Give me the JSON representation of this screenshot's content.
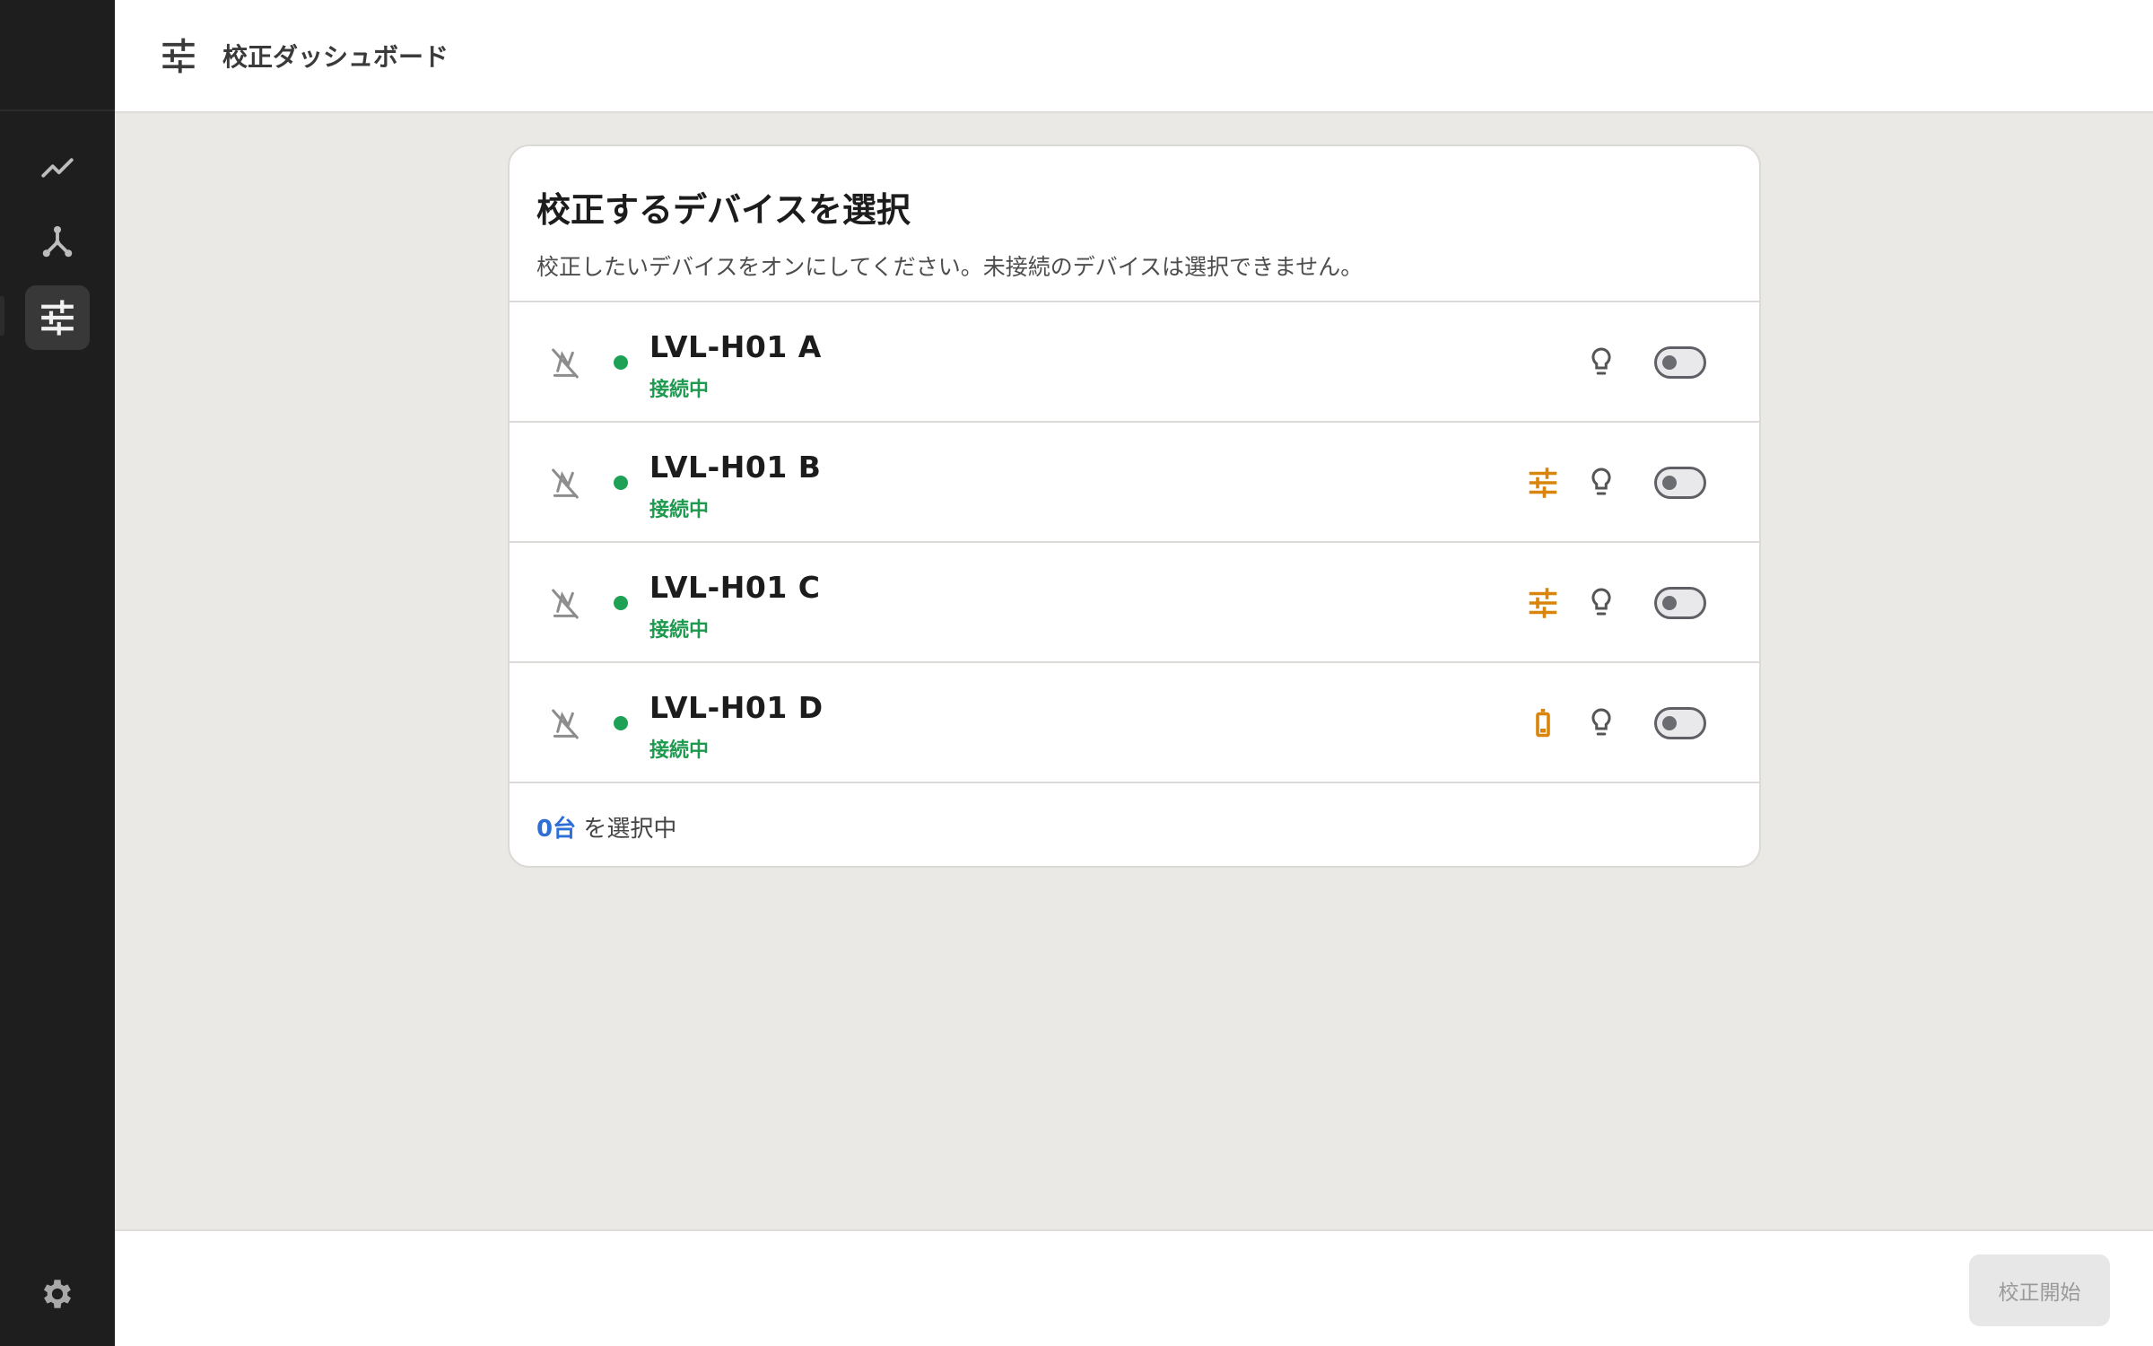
{
  "header": {
    "title": "校正ダッシュボード",
    "icon": "sliders-icon"
  },
  "sidebar": {
    "items": [
      {
        "name": "trend-chart-icon",
        "active": false
      },
      {
        "name": "network-icon",
        "active": false
      },
      {
        "name": "sliders-icon",
        "active": true
      }
    ],
    "settings_icon": "gear-icon"
  },
  "card": {
    "title": "校正するデバイスを選択",
    "description": "校正したいデバイスをオンにしてください。未接続のデバイスは選択できません。"
  },
  "devices": [
    {
      "name": "LVL-H01 A",
      "status": "接続中",
      "warning_icon": null,
      "selected": false
    },
    {
      "name": "LVL-H01 B",
      "status": "接続中",
      "warning_icon": "needs-calibration-icon",
      "selected": false
    },
    {
      "name": "LVL-H01 C",
      "status": "接続中",
      "warning_icon": "needs-calibration-icon",
      "selected": false
    },
    {
      "name": "LVL-H01 D",
      "status": "接続中",
      "warning_icon": "low-battery-icon",
      "selected": false
    }
  ],
  "selection": {
    "count": "0台",
    "suffix": "を選択中"
  },
  "footer": {
    "start_label": "校正開始"
  },
  "colors": {
    "sidebar_bg": "#1e1e1e",
    "connected_green": "#1ea155",
    "warning_orange": "#d9850b",
    "count_blue": "#2e6fd6"
  }
}
